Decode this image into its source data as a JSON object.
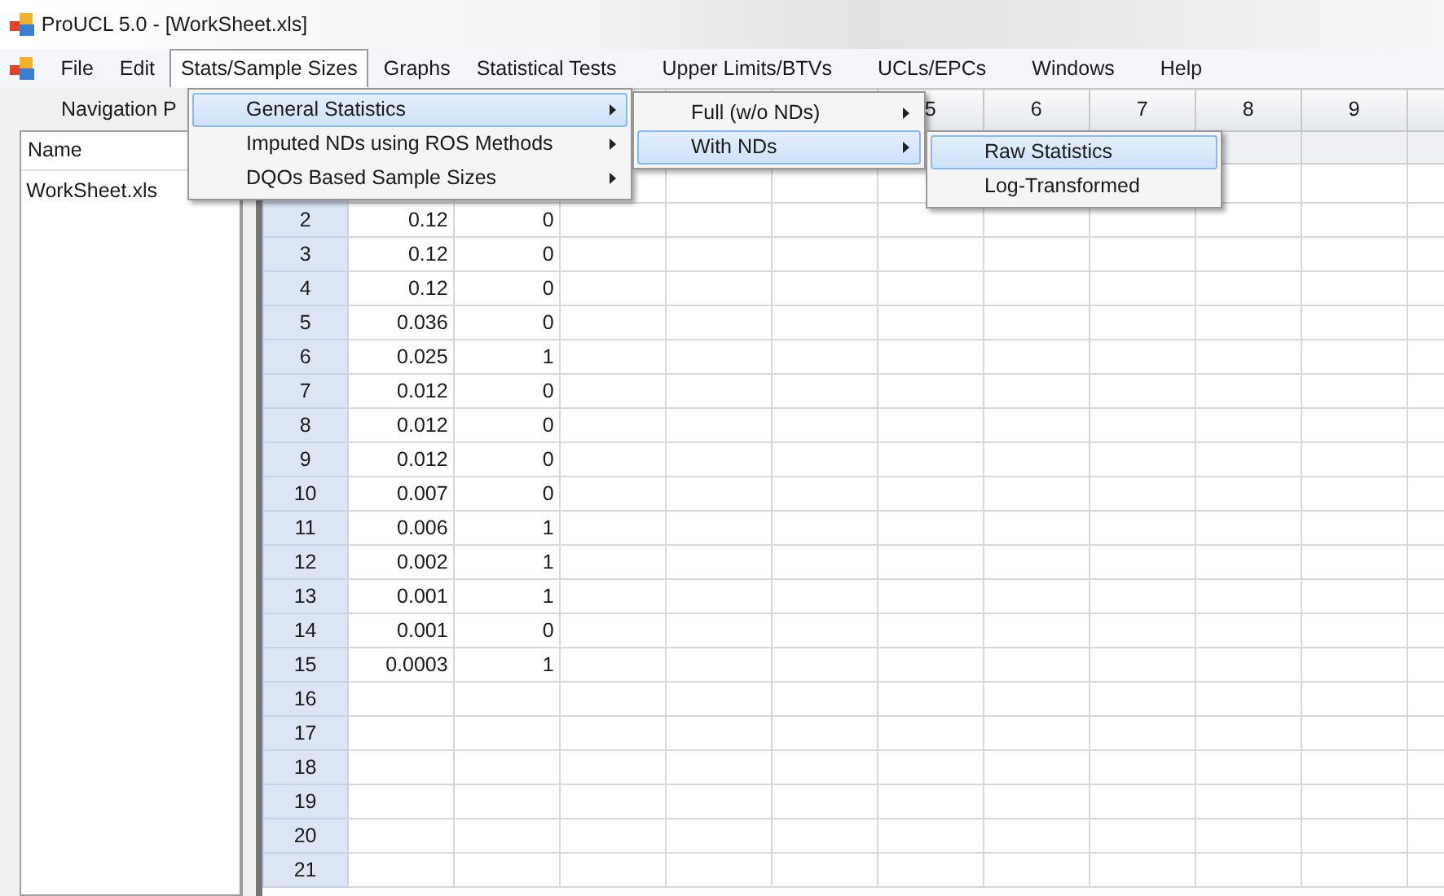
{
  "window": {
    "title": "ProUCL 5.0 - [WorkSheet.xls]"
  },
  "menu_bar": [
    {
      "label": "File",
      "selected": false
    },
    {
      "label": "Edit",
      "selected": false
    },
    {
      "label": "Stats/Sample Sizes",
      "selected": true
    },
    {
      "label": "Graphs",
      "selected": false
    },
    {
      "label": "Statistical Tests",
      "selected": false
    },
    {
      "label": "Upper Limits/BTVs",
      "selected": false
    },
    {
      "label": "UCLs/EPCs",
      "selected": false
    },
    {
      "label": "Windows",
      "selected": false
    },
    {
      "label": "Help",
      "selected": false
    }
  ],
  "menus": [
    {
      "items": [
        {
          "label": "General Statistics",
          "selected": true,
          "has_submenu": true
        },
        {
          "label": "Imputed NDs using ROS Methods",
          "selected": false,
          "has_submenu": true
        },
        {
          "label": "DQOs Based Sample Sizes",
          "selected": false,
          "has_submenu": true
        }
      ]
    },
    {
      "items": [
        {
          "label": "Full (w/o NDs)",
          "selected": false,
          "has_submenu": true
        },
        {
          "label": "With NDs",
          "selected": true,
          "has_submenu": true
        }
      ]
    },
    {
      "items": [
        {
          "label": "Raw Statistics",
          "selected": true,
          "has_submenu": false
        },
        {
          "label": "Log-Transformed",
          "selected": false,
          "has_submenu": false
        }
      ]
    }
  ],
  "navigation_panel": {
    "title": "Navigation P",
    "column": "Name",
    "items": [
      "WorkSheet.xls"
    ]
  },
  "worksheet": {
    "column_headers": [
      "5",
      "6",
      "7",
      "8",
      "9"
    ],
    "rows": [
      {
        "number": "2",
        "cells": [
          "0.12",
          "0"
        ]
      },
      {
        "number": "3",
        "cells": [
          "0.12",
          "0"
        ]
      },
      {
        "number": "4",
        "cells": [
          "0.12",
          "0"
        ]
      },
      {
        "number": "5",
        "cells": [
          "0.036",
          "0"
        ]
      },
      {
        "number": "6",
        "cells": [
          "0.025",
          "1"
        ]
      },
      {
        "number": "7",
        "cells": [
          "0.012",
          "0"
        ]
      },
      {
        "number": "8",
        "cells": [
          "0.012",
          "0"
        ]
      },
      {
        "number": "9",
        "cells": [
          "0.012",
          "0"
        ]
      },
      {
        "number": "10",
        "cells": [
          "0.007",
          "0"
        ]
      },
      {
        "number": "11",
        "cells": [
          "0.006",
          "1"
        ]
      },
      {
        "number": "12",
        "cells": [
          "0.002",
          "1"
        ]
      },
      {
        "number": "13",
        "cells": [
          "0.001",
          "1"
        ]
      },
      {
        "number": "14",
        "cells": [
          "0.001",
          "0"
        ]
      },
      {
        "number": "15",
        "cells": [
          "0.0003",
          "1"
        ]
      },
      {
        "number": "16",
        "cells": []
      },
      {
        "number": "17",
        "cells": []
      },
      {
        "number": "18",
        "cells": []
      },
      {
        "number": "19",
        "cells": []
      },
      {
        "number": "20",
        "cells": []
      },
      {
        "number": "21",
        "cells": []
      }
    ]
  }
}
